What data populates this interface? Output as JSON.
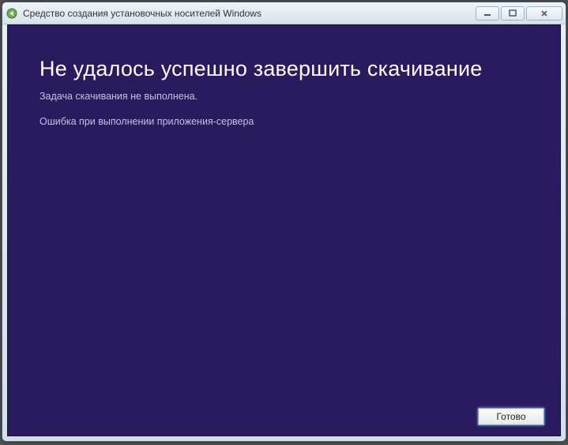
{
  "titlebar": {
    "title": "Средство создания установочных носителей Windows"
  },
  "content": {
    "heading": "Не удалось успешно завершить скачивание",
    "subtext": "Задача скачивания не выполнена.",
    "error": "Ошибка при выполнении приложения-сервера"
  },
  "footer": {
    "done_label": "Готово"
  }
}
